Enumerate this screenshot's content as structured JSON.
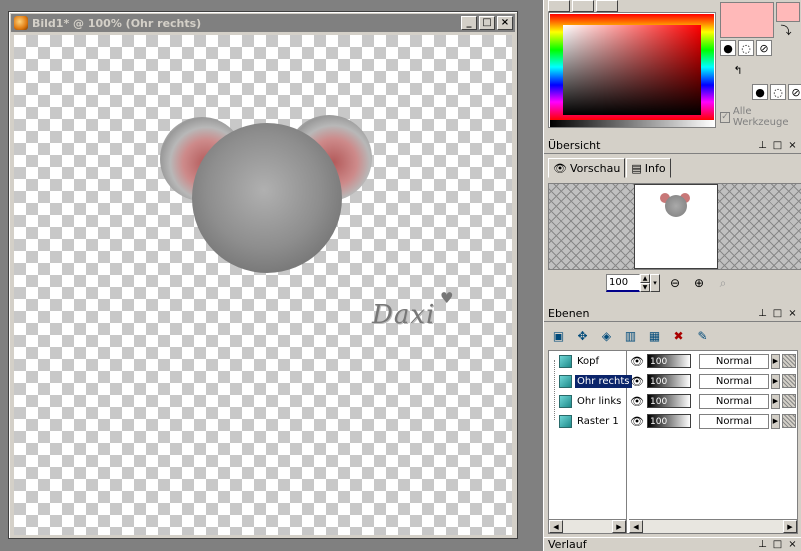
{
  "image_window": {
    "title": "Bild1* @ 100% (Ohr rechts)",
    "signature": "Daxi",
    "signature_heart": "♥"
  },
  "color_panel": {
    "primary_color": "#ffb9b9",
    "secondary_color": "#ffb9b9",
    "all_tools_label": "Alle Werkzeuge",
    "all_tools_checked": true
  },
  "overview": {
    "title": "Übersicht",
    "tabs": [
      {
        "label": "Vorschau",
        "icon": "eye-icon",
        "active": true
      },
      {
        "label": "Info",
        "icon": "document-icon",
        "active": false
      }
    ],
    "zoom_value": "100"
  },
  "layers": {
    "title": "Ebenen",
    "items": [
      {
        "name": "Kopf",
        "opacity": "100",
        "blend": "Normal",
        "selected": false
      },
      {
        "name": "Ohr rechts",
        "opacity": "100",
        "blend": "Normal",
        "selected": true
      },
      {
        "name": "Ohr links",
        "opacity": "100",
        "blend": "Normal",
        "selected": false
      },
      {
        "name": "Raster 1",
        "opacity": "100",
        "blend": "Normal",
        "selected": false
      }
    ]
  },
  "gradient_panel": {
    "title": "Verlauf"
  },
  "panel_controls": [
    "pin-icon",
    "maximize-icon",
    "close-icon"
  ]
}
